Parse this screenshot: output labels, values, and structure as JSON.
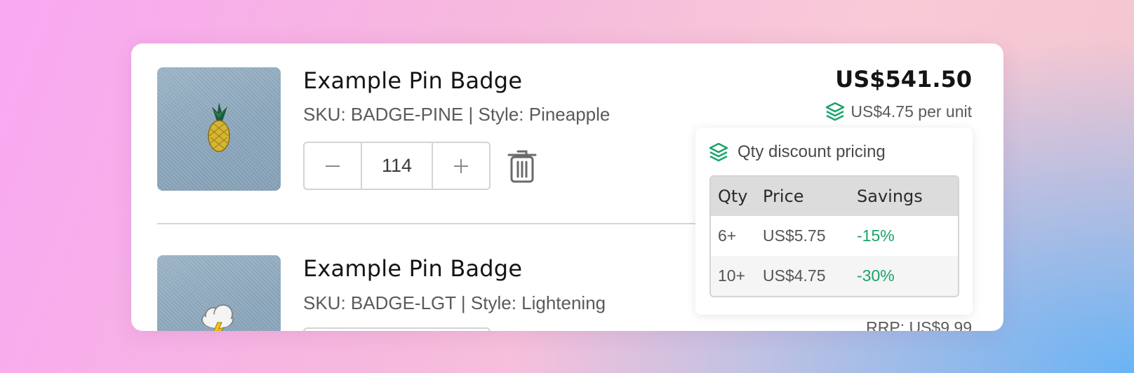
{
  "colors": {
    "accent_green": "#1aa36a",
    "tier_header_bg": "#dcdcdc"
  },
  "items": [
    {
      "name": "Example Pin Badge",
      "meta": "SKU: BADGE-PINE | Style: Pineapple",
      "image_icon": "pineapple-pin-icon",
      "quantity": "114",
      "price": "US$541.50",
      "per_unit": "US$4.75 per unit"
    },
    {
      "name": "Example Pin Badge",
      "meta": "SKU: BADGE-LGT | Style: Lightening",
      "image_icon": "lightning-cloud-pin-icon",
      "rrp": "RRP: US$9.99"
    }
  ],
  "discount": {
    "title": "Qty discount pricing",
    "icon": "layers-icon",
    "headers": [
      "Qty",
      "Price",
      "Savings"
    ],
    "rows": [
      {
        "qty": "6+",
        "price": "US$5.75",
        "savings": "-15%"
      },
      {
        "qty": "10+",
        "price": "US$4.75",
        "savings": "-30%"
      }
    ]
  }
}
